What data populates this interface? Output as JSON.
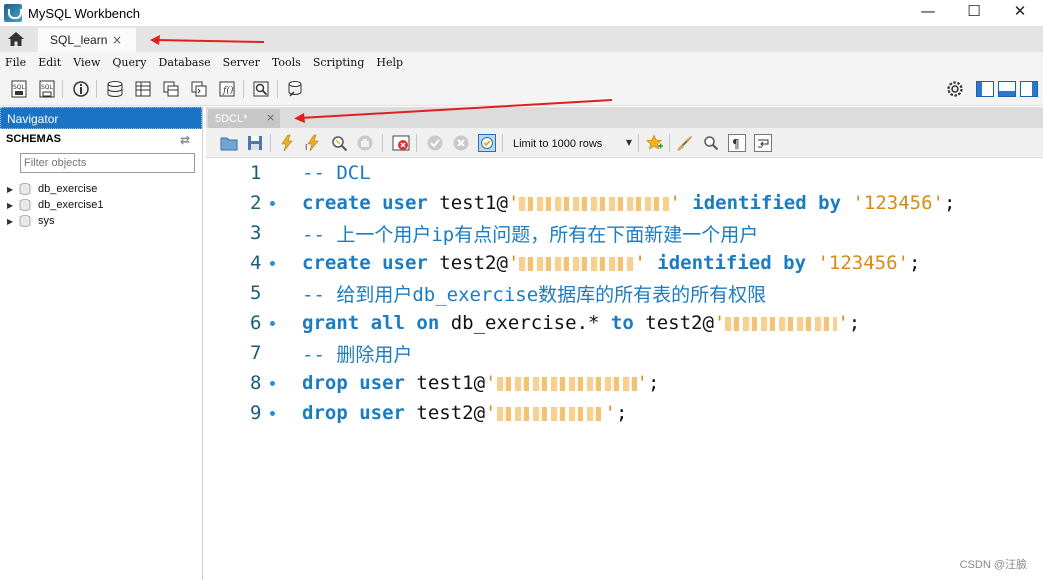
{
  "window": {
    "title": "MySQL Workbench",
    "minimize": "—",
    "maximize": "☐",
    "close": "✕"
  },
  "connection_tab": {
    "label": "SQL_learn",
    "close": "×"
  },
  "menu": [
    "File",
    "Edit",
    "View",
    "Query",
    "Database",
    "Server",
    "Tools",
    "Scripting",
    "Help"
  ],
  "navigator": {
    "header": "Navigator",
    "schemas_label": "SCHEMAS",
    "filter_placeholder": "Filter objects",
    "schemas": [
      "db_exercise",
      "db_exercise1",
      "sys"
    ]
  },
  "editor_tab": {
    "label": "5DCL*",
    "close": "×"
  },
  "editor_toolbar": {
    "limit_label": "Limit to 1000 rows"
  },
  "code_lines": [
    {
      "num": "1",
      "dot": false
    },
    {
      "num": "2",
      "dot": true
    },
    {
      "num": "3",
      "dot": false
    },
    {
      "num": "4",
      "dot": true
    },
    {
      "num": "5",
      "dot": false
    },
    {
      "num": "6",
      "dot": true
    },
    {
      "num": "7",
      "dot": false
    },
    {
      "num": "8",
      "dot": true
    },
    {
      "num": "9",
      "dot": true
    }
  ],
  "code": {
    "l1_comment": "-- DCL",
    "l2_create": "create user",
    "l2_user": "test1@",
    "l2_q1": "'",
    "l2_q2": "'",
    "l2_identified": "identified by",
    "l2_pw": "'123456'",
    "l2_semi": ";",
    "l3_comment": "-- 上一个用户ip有点问题，所有在下面新建一个用户",
    "l4_create": "create user",
    "l4_user": "test2@",
    "l4_q1": "'",
    "l4_q2": "'",
    "l4_identified": "identified by",
    "l4_pw": "'123456'",
    "l4_semi": ";",
    "l5_comment": "-- 给到用户db_exercise数据库的所有表的所有权限",
    "l6_grant": "grant all on",
    "l6_obj": "db_exercise.*",
    "l6_to": "to",
    "l6_user": "test2@",
    "l6_q1": "'",
    "l6_q2": "'",
    "l6_semi": ";",
    "l7_comment": "-- 删除用户",
    "l8_drop": "drop user",
    "l8_user": "test1@",
    "l8_q1": "'",
    "l8_q2": "'",
    "l8_semi": ";",
    "l9_drop": "drop user",
    "l9_user": "test2@",
    "l9_q1": "'",
    "l9_q2": "'",
    "l9_semi": ";"
  },
  "watermark": "CSDN @汪臉",
  "colors": {
    "navigator_header": "#1b73c6",
    "keyword": "#1a7cc2",
    "string": "#d98b12",
    "annotation_arrow": "#e02020"
  }
}
